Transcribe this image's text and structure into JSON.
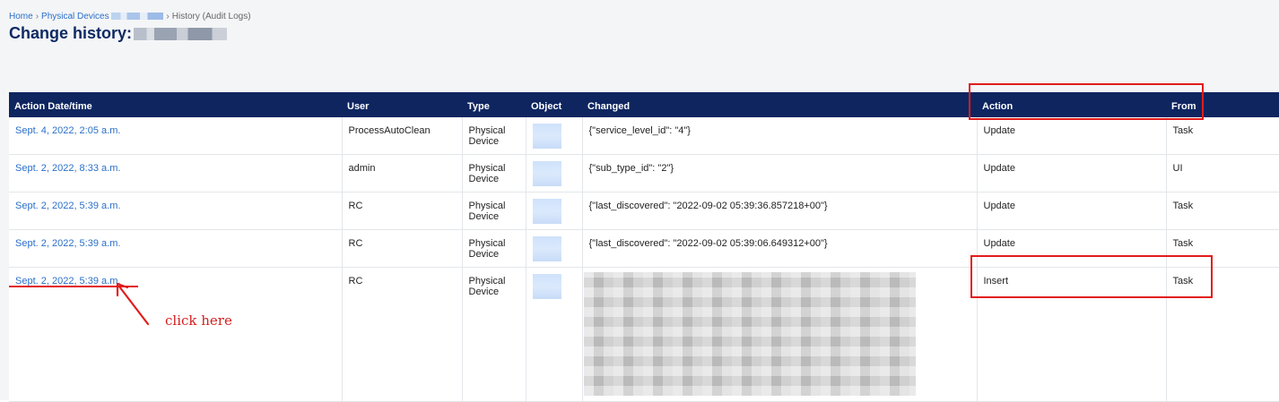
{
  "breadcrumb": {
    "home": "Home",
    "physical_devices": "Physical Devices",
    "history": "History (Audit Logs)"
  },
  "page_title": "Change history:",
  "table": {
    "columns": [
      "Action Date/time",
      "User",
      "Type",
      "Object",
      "Changed",
      "Action",
      "From"
    ],
    "rows": [
      {
        "date": "Sept. 4, 2022, 2:05 a.m.",
        "user": "ProcessAutoClean",
        "type": "Physical Device",
        "changed": "{\"service_level_id\": \"4\"}",
        "action": "Update",
        "from": "Task"
      },
      {
        "date": "Sept. 2, 2022, 8:33 a.m.",
        "user": "admin",
        "type": "Physical Device",
        "changed": "{\"sub_type_id\": \"2\"}",
        "action": "Update",
        "from": "UI"
      },
      {
        "date": "Sept. 2, 2022, 5:39 a.m.",
        "user": "RC",
        "type": "Physical Device",
        "changed": "{\"last_discovered\": \"2022-09-02 05:39:36.857218+00\"}",
        "action": "Update",
        "from": "Task"
      },
      {
        "date": "Sept. 2, 2022, 5:39 a.m.",
        "user": "RC",
        "type": "Physical Device",
        "changed": "{\"last_discovered\": \"2022-09-02 05:39:06.649312+00\"}",
        "action": "Update",
        "from": "Task"
      },
      {
        "date": "Sept. 2, 2022, 5:39 a.m.",
        "user": "RC",
        "type": "Physical Device",
        "changed": "",
        "action": "Insert",
        "from": "Task"
      }
    ]
  },
  "annotation": {
    "text": "click here",
    "color": "#e21c1c"
  },
  "colors": {
    "header_bg": "#0e2560",
    "title": "#0e2a63",
    "link": "#2a6fc9",
    "highlight": "#e21c1c"
  }
}
